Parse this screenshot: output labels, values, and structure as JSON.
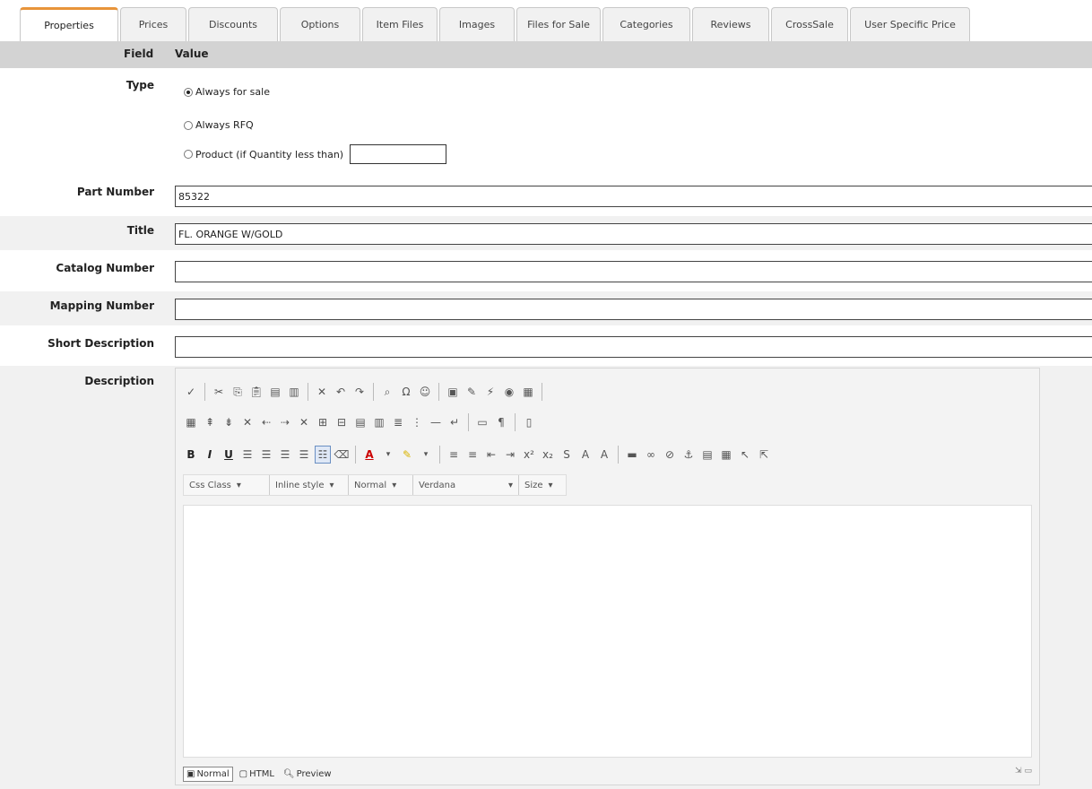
{
  "tabs": [
    "Properties",
    "Prices",
    "Discounts",
    "Options",
    "Item Files",
    "Images",
    "Files for Sale",
    "Categories",
    "Reviews",
    "CrossSale",
    "User Specific Price"
  ],
  "header": {
    "field": "Field",
    "value": "Value"
  },
  "type_field": {
    "label": "Type",
    "options": [
      "Always for sale",
      "Always RFQ",
      "Product (if Quantity less than)"
    ],
    "selected": 0
  },
  "part_number": {
    "label": "Part Number",
    "value": "85322"
  },
  "title": {
    "label": "Title",
    "value": "FL. ORANGE W/GOLD"
  },
  "catalog_number": {
    "label": "Catalog Number",
    "value": ""
  },
  "mapping_number": {
    "label": "Mapping Number",
    "value": ""
  },
  "short_description": {
    "label": "Short Description",
    "value": ""
  },
  "description": {
    "label": "Description"
  },
  "editor": {
    "dropdowns": [
      "Css Class",
      "Inline style",
      "Normal",
      "Verdana",
      "Size"
    ],
    "modes": [
      "Normal",
      "HTML",
      "Preview"
    ],
    "active_mode": "Normal",
    "icons_row1": [
      "spellcheck-icon",
      "cut-icon",
      "copy-icon",
      "paste-icon",
      "paste-text-icon",
      "paste-word-icon",
      "clear-icon",
      "undo-icon",
      "redo-icon",
      "find-icon",
      "special-char-icon",
      "emoticon-icon",
      "image-icon",
      "document-icon",
      "flash-icon",
      "media-icon",
      "pdf-icon"
    ],
    "icons_row2": [
      "table-icon",
      "insert-row-before-icon",
      "insert-row-after-icon",
      "delete-row-icon",
      "insert-col-before-icon",
      "insert-col-after-icon",
      "delete-col-icon",
      "merge-icon",
      "split-icon",
      "cell-props-icon",
      "table-props-icon",
      "row-props-icon",
      "col-props-icon",
      "hr-icon",
      "break-icon",
      "show-borders-icon",
      "paragraph-icon",
      "template-icon"
    ]
  }
}
